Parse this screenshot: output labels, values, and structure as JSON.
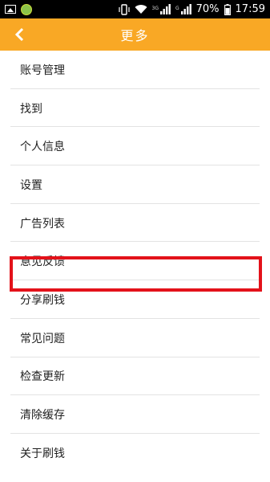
{
  "status_bar": {
    "network_3g": "3G",
    "network_g": "G",
    "battery": "70%",
    "time": "17:59"
  },
  "header": {
    "title": "更多"
  },
  "menu": {
    "items": [
      {
        "label": "账号管理"
      },
      {
        "label": "找到"
      },
      {
        "label": "个人信息"
      },
      {
        "label": "设置"
      },
      {
        "label": "广告列表"
      },
      {
        "label": "意见反馈"
      },
      {
        "label": "分享刷钱"
      },
      {
        "label": "常见问题"
      },
      {
        "label": "检查更新"
      },
      {
        "label": "清除缓存"
      },
      {
        "label": "关于刷钱"
      }
    ]
  },
  "colors": {
    "header": "#f9a825",
    "highlight": "#e3121a"
  }
}
